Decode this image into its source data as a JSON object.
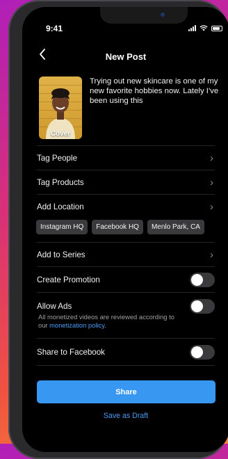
{
  "status_bar": {
    "time": "9:41"
  },
  "nav": {
    "title": "New Post"
  },
  "post": {
    "cover_label": "Cover",
    "caption": "Trying out new skincare is one of my new favorite hobbies now. Lately I've been using this"
  },
  "rows": {
    "tag_people": "Tag People",
    "tag_products": "Tag Products",
    "add_location": "Add Location",
    "add_to_series": "Add to Series",
    "create_promotion": "Create Promotion",
    "allow_ads": "Allow Ads",
    "share_to_facebook": "Share to Facebook"
  },
  "location_suggestions": [
    "Instagram HQ",
    "Facebook HQ",
    "Menlo Park, CA"
  ],
  "allow_ads_note": {
    "text": "All monetized videos are reviewed according to our",
    "link": "monetization policy",
    "suffix": "."
  },
  "toggles": {
    "create_promotion": false,
    "allow_ads": false,
    "share_to_facebook": false
  },
  "actions": {
    "share": "Share",
    "save_draft": "Save as Draft"
  },
  "colors": {
    "accent": "#3897f0",
    "link": "#4a9cf5",
    "background": "#000000"
  },
  "icons": {
    "back": "chevron-left-icon",
    "row_arrow": "chevron-right-icon"
  }
}
